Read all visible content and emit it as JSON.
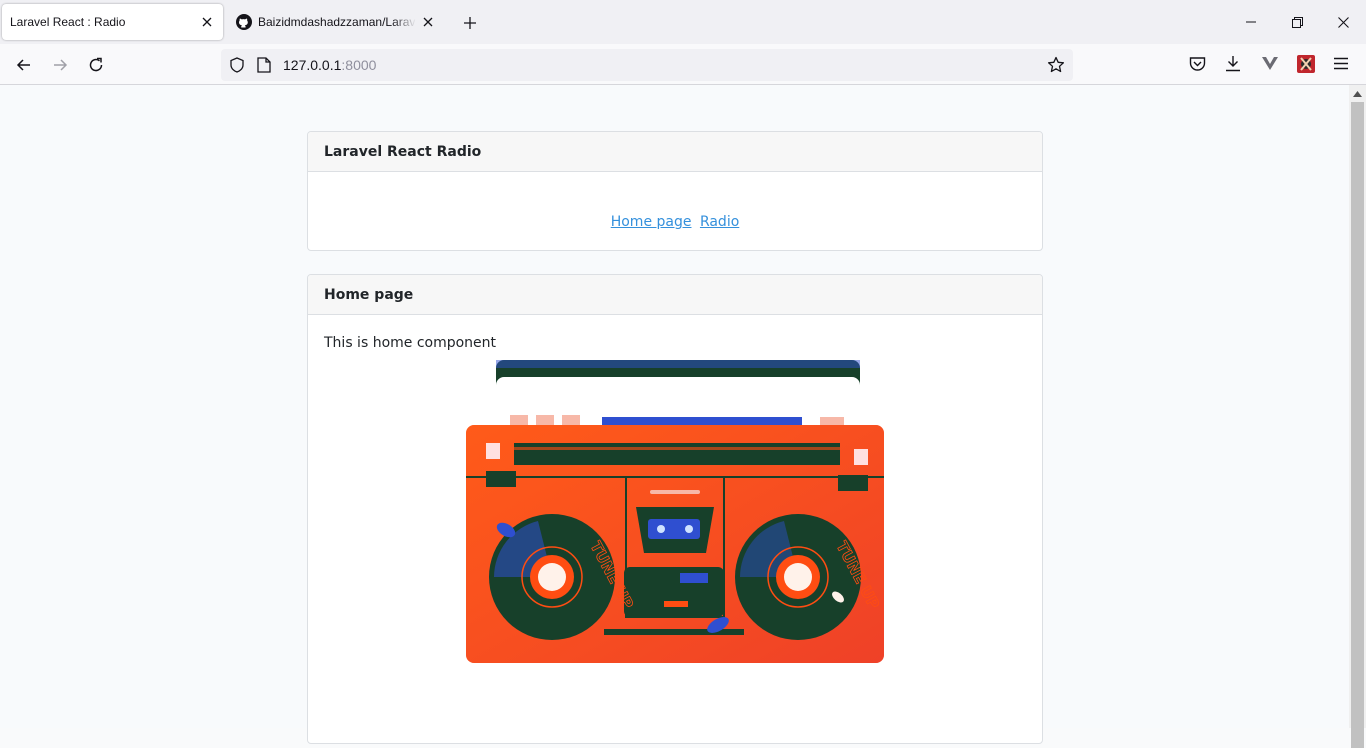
{
  "browser": {
    "tabs": [
      {
        "title": "Laravel React : Radio",
        "active": true
      },
      {
        "title": "Baizidmdashadzzaman/Laravel-",
        "active": false
      }
    ],
    "url_host": "127.0.0.1",
    "url_port": ":8000"
  },
  "page": {
    "nav_card": {
      "title": "Laravel React Radio",
      "links": [
        "Home page",
        "Radio"
      ]
    },
    "home_card": {
      "title": "Home page",
      "text": "This is home component"
    },
    "illustration": {
      "name": "boombox-illustration",
      "speaker_text": "TUNE UP",
      "colors": {
        "body": "#ff4d12",
        "dark": "#17402a",
        "accent": "#2f4fd0"
      }
    }
  }
}
